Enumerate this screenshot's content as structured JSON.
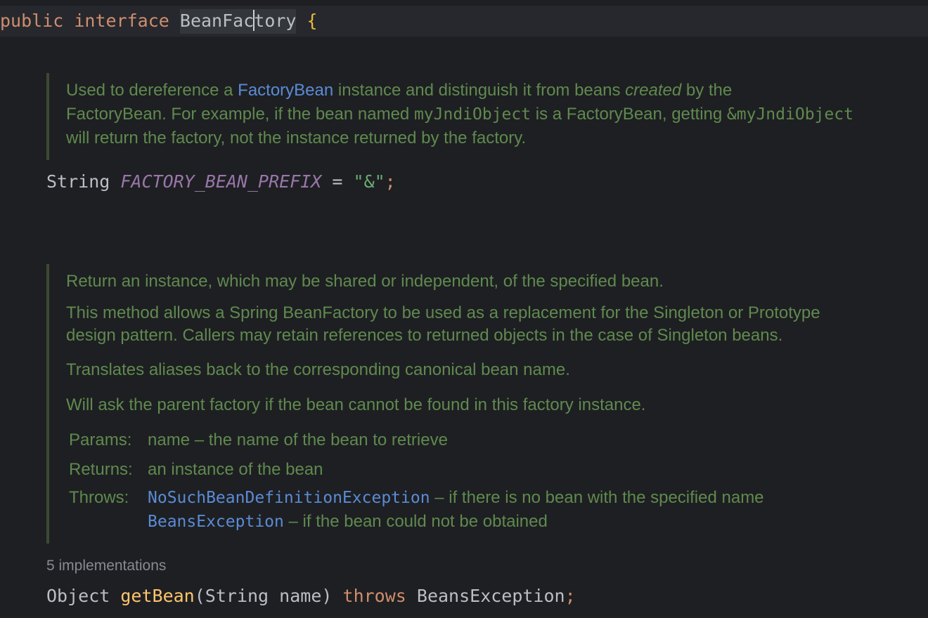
{
  "colors": {
    "background": "#1e1f22",
    "keyword": "#cf8e6d",
    "doc_text": "#5f8a4f",
    "doc_link": "#5a8bd6",
    "constant": "#9876aa",
    "string": "#6aab73",
    "method": "#ffc66d"
  },
  "line1": {
    "kw_public": "public",
    "kw_interface": "interface",
    "name_before_caret": "BeanFac",
    "name_after_caret": "tory",
    "open_brace": "{"
  },
  "doc1": {
    "t1": "Used to dereference a ",
    "link_factory_bean": "FactoryBean",
    "t2": " instance and distinguish it from beans ",
    "em_created": "created",
    "t3": " by the",
    "t4": "FactoryBean. For example, if the bean named ",
    "code_my_jndi": "myJndiObject",
    "t5": " is a FactoryBean, getting ",
    "code_amp_my_jndi": "&myJndiObject",
    "t6": "will return the factory, not the instance returned by the factory."
  },
  "field": {
    "type": "String",
    "name": "FACTORY_BEAN_PREFIX",
    "eq": " = ",
    "value": "\"&\"",
    "semicolon": ";"
  },
  "doc2": {
    "p1": "Return an instance, which may be shared or independent, of the specified bean.",
    "p2a": "This method allows a Spring BeanFactory to be used as a replacement for the Singleton or Prototype",
    "p2b": "design pattern. Callers may retain references to returned objects in the case of Singleton beans.",
    "p3": "Translates aliases back to the corresponding canonical bean name.",
    "p4": "Will ask the parent factory if the bean cannot be found in this factory instance.",
    "params_label": "Params:",
    "param_name": "name",
    "param_desc": " – the name of the bean to retrieve",
    "returns_label": "Returns:",
    "returns_desc": "an instance of the bean",
    "throws_label": "Throws:",
    "throws1_link": "NoSuchBeanDefinitionException",
    "throws1_desc": " – if there is no bean with the specified name",
    "throws2_link": "BeansException",
    "throws2_desc": " – if the bean could not be obtained"
  },
  "implementations_hint": "5 implementations",
  "method": {
    "return_type": "Object",
    "name": "getBean",
    "open_paren": "(",
    "param_type": "String",
    "param_name": "name",
    "close_paren": ")",
    "kw_throws": "throws",
    "exception": "BeansException",
    "semicolon": ";"
  }
}
